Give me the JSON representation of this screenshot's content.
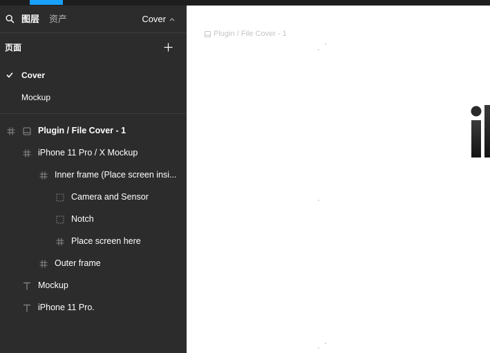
{
  "panel": {
    "tabs": {
      "layers": "图层",
      "assets": "资产"
    },
    "current_page": "Cover"
  },
  "pages": {
    "header": "页面",
    "items": [
      {
        "label": "Cover",
        "selected": true
      },
      {
        "label": "Mockup",
        "selected": false
      }
    ]
  },
  "layers": [
    {
      "label": "Plugin / File Cover - 1",
      "icon": "frame-icon",
      "depth": 0,
      "bold": true
    },
    {
      "label": "iPhone 11 Pro / X Mockup",
      "icon": "frame-icon",
      "depth": 1,
      "bold": false
    },
    {
      "label": "Inner frame (Place screen insi...",
      "icon": "frame-icon",
      "depth": 2,
      "bold": false
    },
    {
      "label": "Camera and Sensor",
      "icon": "group-icon",
      "depth": 3,
      "bold": false
    },
    {
      "label": "Notch",
      "icon": "group-icon",
      "depth": 3,
      "bold": false
    },
    {
      "label": "Place screen here",
      "icon": "frame-icon",
      "depth": 3,
      "bold": false
    },
    {
      "label": "Outer frame",
      "icon": "frame-icon",
      "depth": 2,
      "bold": false
    },
    {
      "label": "Mockup",
      "icon": "text-icon",
      "depth": 1,
      "bold": false
    },
    {
      "label": "iPhone 11 Pro.",
      "icon": "text-icon",
      "depth": 1,
      "bold": false
    }
  ],
  "canvas": {
    "frame_label": "Plugin / File Cover - 1"
  },
  "colors": {
    "panel_bg": "#2c2c2c",
    "accent": "#18a0fb",
    "canvas_bg": "#ffffff",
    "icon_gray": "#8c8c8c"
  }
}
